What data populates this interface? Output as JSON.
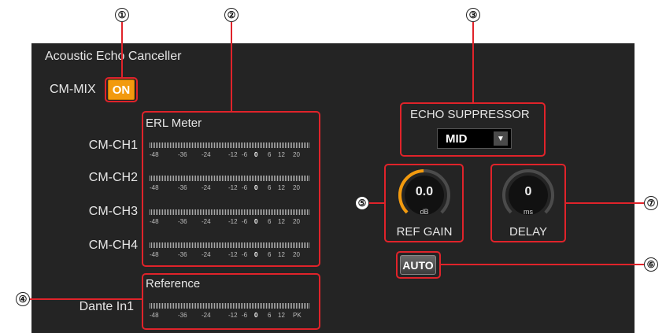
{
  "title": "Acoustic Echo Canceller",
  "cm_mix": {
    "label": "CM-MIX",
    "toggle": "ON"
  },
  "erl_meter": {
    "heading": "ERL Meter",
    "channels": [
      {
        "label": "CM-CH1"
      },
      {
        "label": "CM-CH2"
      },
      {
        "label": "CM-CH3"
      },
      {
        "label": "CM-CH4"
      }
    ],
    "scale": [
      "-48",
      "-36",
      "-24",
      "-12",
      "-6",
      "0",
      "6",
      "12",
      "20"
    ]
  },
  "reference": {
    "heading": "Reference",
    "channel": "Dante In1",
    "scale": [
      "-48",
      "-36",
      "-24",
      "-12",
      "-6",
      "0",
      "6",
      "12",
      "PK"
    ]
  },
  "echo_suppressor": {
    "heading": "ECHO SUPPRESSOR",
    "selected": "MID"
  },
  "ref_gain": {
    "value": "0.0",
    "unit": "dB",
    "label": "REF GAIN"
  },
  "delay": {
    "value": "0",
    "unit": "ms",
    "label": "DELAY"
  },
  "auto_button": "AUTO",
  "callouts": [
    "①",
    "②",
    "③",
    "④",
    "⑤",
    "⑥",
    "⑦"
  ],
  "colors": {
    "accent_orange": "#f29a0e",
    "highlight_red": "#e0232a",
    "panel_bg": "#242424"
  }
}
